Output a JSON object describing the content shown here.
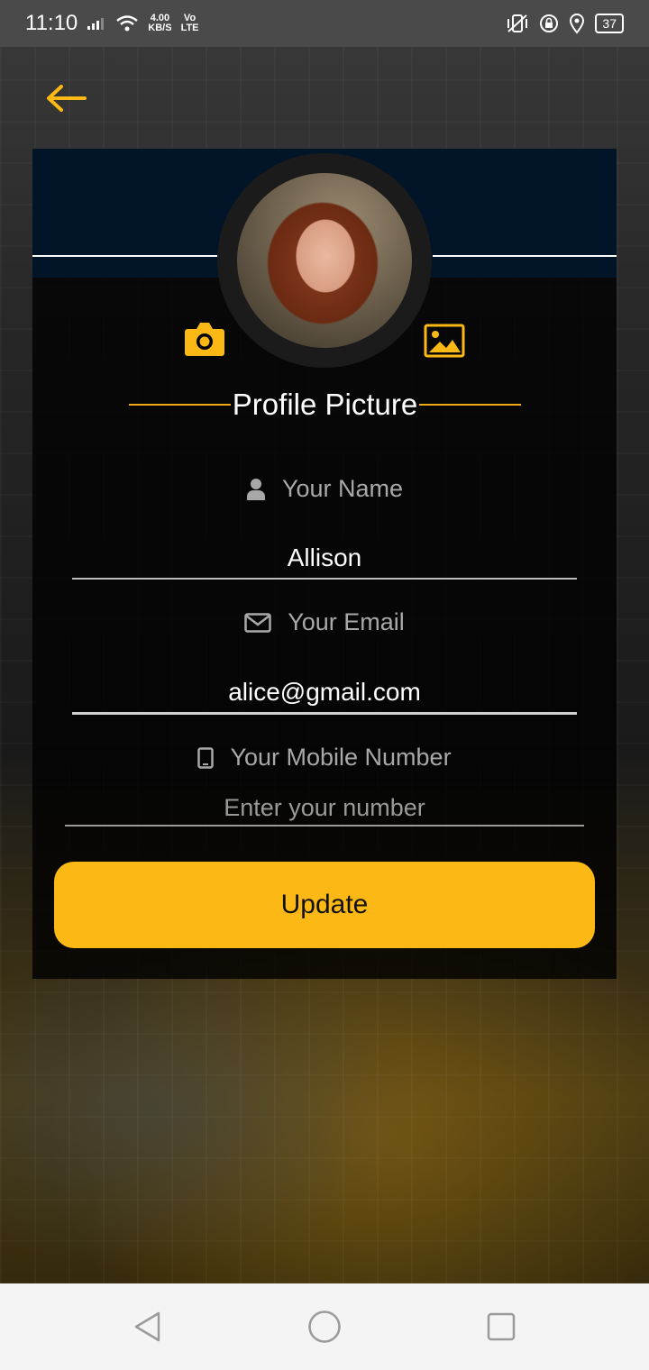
{
  "statusbar": {
    "time": "11:10",
    "net_speed": "4.00",
    "net_unit": "KB/S",
    "volte_top": "Vo",
    "volte_bottom": "LTE",
    "battery": "37"
  },
  "profile": {
    "section_label": "Profile Picture",
    "accent_color": "#fcb814",
    "header_color": "#021427"
  },
  "form": {
    "name_label": "Your Name",
    "name_value": "Allison",
    "email_label": "Your Email",
    "email_value": "alice@gmail.com",
    "mobile_label": "Your Mobile Number",
    "mobile_placeholder": "Enter your number",
    "mobile_value": ""
  },
  "actions": {
    "update_label": "Update"
  },
  "icons": {
    "back": "arrow-left-icon",
    "camera": "camera-icon",
    "gallery": "image-icon",
    "user": "user-icon",
    "email": "envelope-icon",
    "mobile": "mobile-icon"
  }
}
